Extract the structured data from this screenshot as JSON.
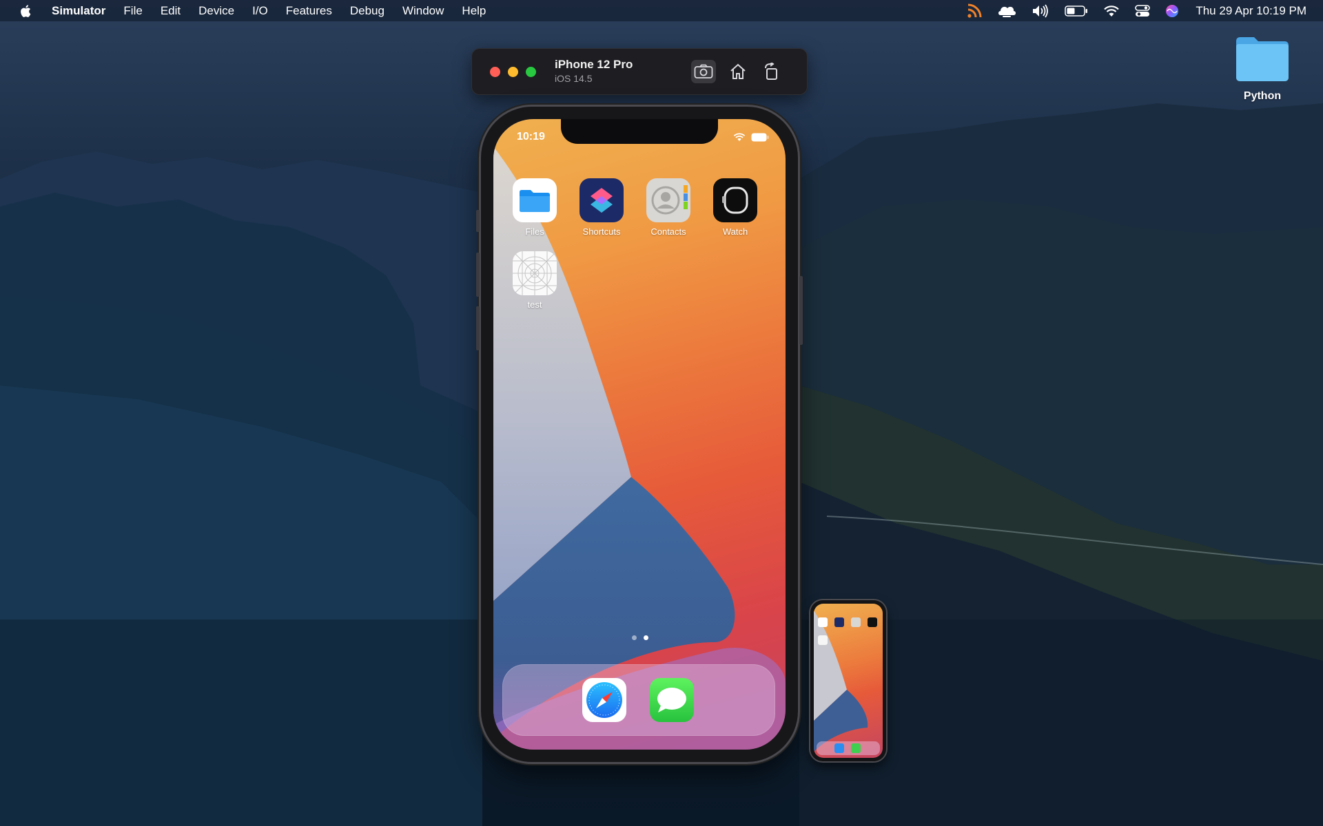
{
  "menubar": {
    "app_name": "Simulator",
    "items": [
      "File",
      "Edit",
      "Device",
      "I/O",
      "Features",
      "Debug",
      "Window",
      "Help"
    ],
    "clock": "Thu 29 Apr  10:19 PM"
  },
  "desktop": {
    "folder": {
      "label": "Python",
      "icon": "folder-icon"
    }
  },
  "simulator": {
    "device_name": "iPhone 12 Pro",
    "os_version": "iOS 14.5",
    "toolbar_icons": [
      "screenshot-icon",
      "home-icon",
      "rotate-icon"
    ]
  },
  "iphone": {
    "status_time": "10:19",
    "apps": [
      {
        "label": "Files",
        "icon": "files-icon"
      },
      {
        "label": "Shortcuts",
        "icon": "shortcuts-icon"
      },
      {
        "label": "Contacts",
        "icon": "contacts-icon"
      },
      {
        "label": "Watch",
        "icon": "watch-icon"
      },
      {
        "label": "test",
        "icon": "placeholder-app-icon"
      }
    ],
    "page_dots": {
      "count": 2,
      "active": 2
    },
    "dock": [
      {
        "icon": "safari-icon"
      },
      {
        "icon": "messages-icon"
      }
    ]
  },
  "colors": {
    "close": "#ff5f57",
    "minimize": "#febc2e",
    "zoom": "#28c840",
    "folder": "#5ab8f0",
    "rss": "#f0822a"
  }
}
